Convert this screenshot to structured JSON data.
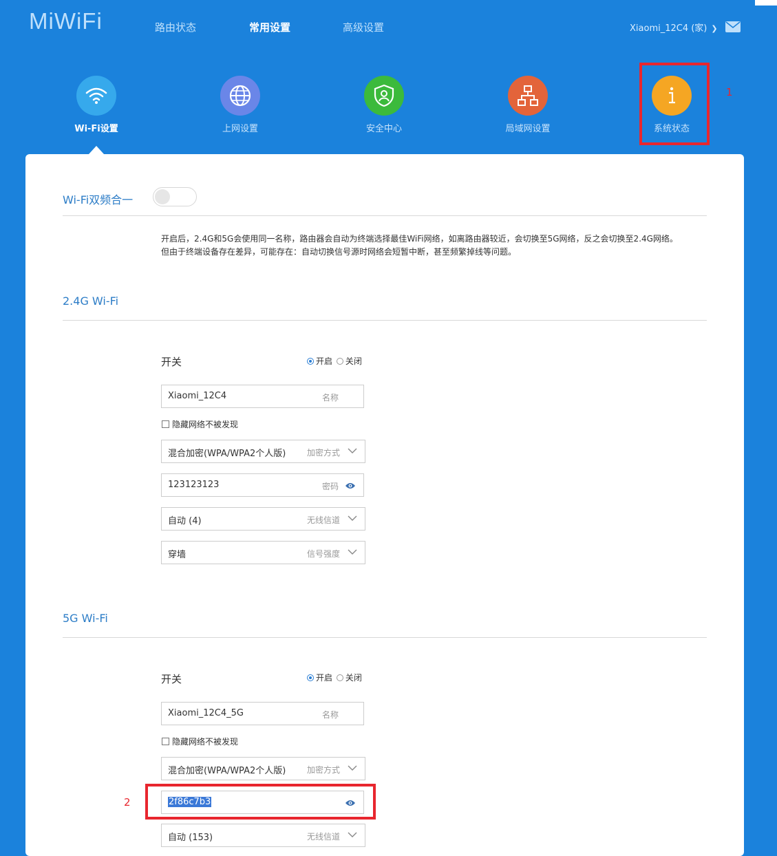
{
  "header": {
    "logo": "MiWiFi",
    "nav": [
      "路由状态",
      "常用设置",
      "高级设置"
    ],
    "active_nav": "常用设置",
    "device": "Xiaomi_12C4 (家)"
  },
  "categories": [
    {
      "label": "Wi-Fi设置",
      "icon": "wifi-icon",
      "color": "#36a9ec"
    },
    {
      "label": "上网设置",
      "icon": "globe-icon",
      "color": "#6a86e8"
    },
    {
      "label": "安全中心",
      "icon": "shield-icon",
      "color": "#3cba3c"
    },
    {
      "label": "局域网设置",
      "icon": "network-icon",
      "color": "#e3643a"
    },
    {
      "label": "系统状态",
      "icon": "info-icon",
      "color": "#f5a623"
    }
  ],
  "annotations": {
    "one": "1",
    "two": "2"
  },
  "dual_band": {
    "title": "Wi-Fi双频合一",
    "enabled": false,
    "desc_line1": "开启后，2.4G和5G会使用同一名称，路由器会自动为终端选择最佳WiFi网络，如离路由器较近，会切换至5G网络，反之会切换至2.4G网络。",
    "desc_line2": "但由于终端设备存在差异，可能存在：自动切换信号源时网络会短暂中断，甚至频繁掉线等问题。"
  },
  "wifi24": {
    "title": "2.4G Wi-Fi",
    "switch_label": "开关",
    "radio_on": "开启",
    "radio_off": "关闭",
    "ssid": "Xiaomi_12C4",
    "ssid_placeholder": "名称",
    "hide_label": "隐藏网络不被发现",
    "encryption": "混合加密(WPA/WPA2个人版)",
    "encryption_label": "加密方式",
    "password": "123123123",
    "password_label": "密码",
    "channel": "自动 (4)",
    "channel_label": "无线信道",
    "strength": "穿墙",
    "strength_label": "信号强度"
  },
  "wifi5": {
    "title": "5G Wi-Fi",
    "switch_label": "开关",
    "radio_on": "开启",
    "radio_off": "关闭",
    "ssid": "Xiaomi_12C4_5G",
    "ssid_placeholder": "名称",
    "hide_label": "隐藏网络不被发现",
    "encryption": "混合加密(WPA/WPA2个人版)",
    "encryption_label": "加密方式",
    "password": "2f86c7b3",
    "channel": "自动 (153)",
    "channel_label": "无线信道"
  }
}
